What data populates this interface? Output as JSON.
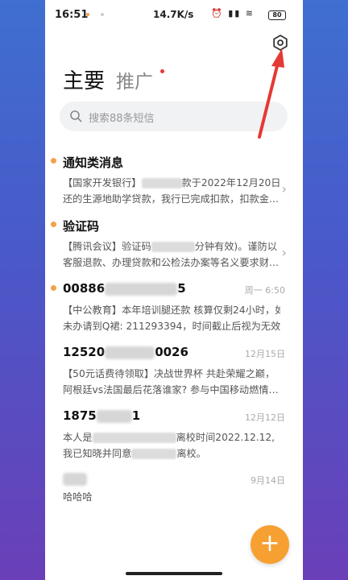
{
  "status_bar": {
    "time": "16:51",
    "speed": "14.7K/s",
    "icons": "⏰ ▮▮ ≋",
    "battery": "80"
  },
  "tabs": {
    "main": "主要",
    "promo": "推广"
  },
  "search": {
    "placeholder": "搜索88条短信"
  },
  "messages": [
    {
      "title": "通知类消息",
      "time": "",
      "line1_a": "【国家开发银行】",
      "line1_b": "款于2022年12月20日应",
      "line2": "还的生源地助学贷款，我行已完成扣款，扣款金…",
      "unread": true
    },
    {
      "title": "验证码",
      "time": "",
      "line1_a": "【腾讯会议】验证码",
      "line1_b": "分钟有效)。谨防以",
      "line2": "客服退款、办理贷款和公检法办案等名义要求财…",
      "unread": true
    },
    {
      "title_a": "00886",
      "title_b": "5",
      "time": "周一 6:50",
      "line1": "【中公教育】本年培训腿还款 核算仅剩24小时，如",
      "line2": "未办请到Q裙: 211293394，时间截止后视为无效",
      "unread": true
    },
    {
      "title_a": "12520",
      "title_b": "0026",
      "time": "12月15日",
      "line1": "【50元话费待领取】决战世界杯 共赴荣耀之巅，",
      "line2": "阿根廷vs法国最后花落谁家? 参与中国移动燃情…",
      "unread": false
    },
    {
      "title_a": "1875",
      "title_b": "1",
      "time": "12月12日",
      "line1_a": "本人是",
      "line1_b": "离校时间2022.12.12,",
      "line2_a": "我已知晓并同意",
      "line2_b": "离校。",
      "unread": false
    },
    {
      "time": "9月14日",
      "line1": "哈哈哈",
      "unread": false
    }
  ],
  "fab": {
    "label": "+"
  }
}
